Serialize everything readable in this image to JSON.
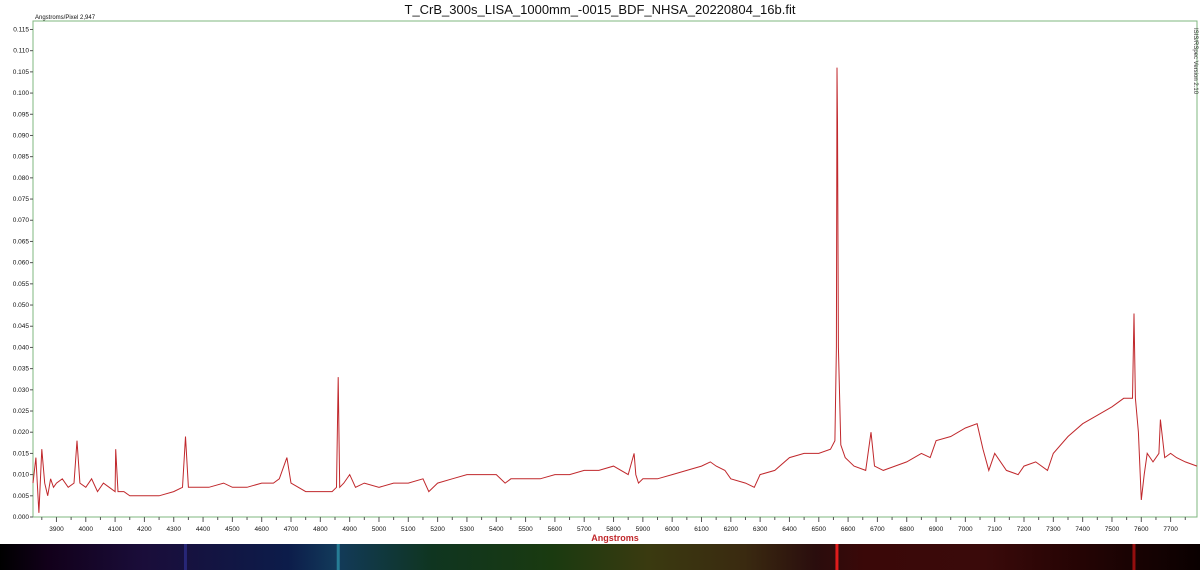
{
  "title": "T_CrB_300s_LISA_1000mm_-0015_BDF_NHSA_20220804_16b.fit",
  "dispersion_label": "Angstroms/Pixel 2,947",
  "app_credit": "ISIS/RSpec Version 2.10",
  "colors": {
    "line": "#c0282c",
    "axis_label": "#c0282c",
    "frame": "#7fb77f",
    "text": "#111111"
  },
  "chart_data": {
    "type": "line",
    "title": "T_CrB_300s_LISA_1000mm_-0015_BDF_NHSA_20220804_16b.fit",
    "xlabel": "Angstroms",
    "ylabel": "",
    "xlim": [
      3820,
      7790
    ],
    "ylim": [
      0,
      0.117
    ],
    "grid": false,
    "x_ticks": [
      3900,
      4000,
      4100,
      4200,
      4300,
      4400,
      4500,
      4600,
      4700,
      4800,
      4900,
      5000,
      5100,
      5200,
      5300,
      5400,
      5500,
      5600,
      5700,
      5800,
      5900,
      6000,
      6100,
      6200,
      6300,
      6400,
      6500,
      6600,
      6700,
      6800,
      6900,
      7000,
      7100,
      7200,
      7300,
      7400,
      7500,
      7600,
      7700
    ],
    "y_ticks": [
      "0.000",
      "0.005",
      "0.010",
      "0.015",
      "0.020",
      "0.025",
      "0.030",
      "0.035",
      "0.040",
      "0.045",
      "0.050",
      "0.055",
      "0.060",
      "0.065",
      "0.070",
      "0.075",
      "0.080",
      "0.085",
      "0.090",
      "0.095",
      "0.100",
      "0.105",
      "0.110",
      "0.115"
    ],
    "series": [
      {
        "x": [
          3820,
          3830,
          3840,
          3850,
          3860,
          3870,
          3880,
          3890,
          3900,
          3920,
          3940,
          3960,
          3970,
          3980,
          4000,
          4020,
          4040,
          4060,
          4080,
          4100,
          4102,
          4110,
          4130,
          4150,
          4200,
          4250,
          4300,
          4330,
          4340,
          4350,
          4380,
          4420,
          4470,
          4500,
          4550,
          4600,
          4640,
          4660,
          4686,
          4700,
          4750,
          4800,
          4840,
          4855,
          4861,
          4866,
          4880,
          4900,
          4920,
          4950,
          5000,
          5050,
          5100,
          5150,
          5170,
          5200,
          5250,
          5300,
          5350,
          5400,
          5430,
          5450,
          5500,
          5550,
          5600,
          5650,
          5700,
          5750,
          5800,
          5850,
          5870,
          5876,
          5885,
          5900,
          5950,
          6000,
          6050,
          6100,
          6130,
          6150,
          6180,
          6200,
          6250,
          6280,
          6300,
          6350,
          6400,
          6450,
          6500,
          6540,
          6555,
          6560,
          6562,
          6564,
          6567,
          6575,
          6590,
          6620,
          6660,
          6678,
          6690,
          6720,
          6760,
          6800,
          6850,
          6880,
          6900,
          6950,
          7000,
          7040,
          7060,
          7080,
          7100,
          7140,
          7180,
          7200,
          7240,
          7280,
          7300,
          7350,
          7400,
          7450,
          7500,
          7540,
          7570,
          7575,
          7580,
          7590,
          7600,
          7610,
          7620,
          7640,
          7660,
          7665,
          7680,
          7700,
          7720,
          7750,
          7790
        ],
        "y": [
          0.008,
          0.014,
          0.001,
          0.016,
          0.008,
          0.005,
          0.009,
          0.007,
          0.008,
          0.009,
          0.007,
          0.008,
          0.018,
          0.008,
          0.007,
          0.009,
          0.006,
          0.008,
          0.007,
          0.006,
          0.016,
          0.006,
          0.006,
          0.005,
          0.005,
          0.005,
          0.006,
          0.007,
          0.019,
          0.007,
          0.007,
          0.007,
          0.008,
          0.007,
          0.007,
          0.008,
          0.008,
          0.009,
          0.014,
          0.008,
          0.006,
          0.006,
          0.006,
          0.007,
          0.033,
          0.007,
          0.008,
          0.01,
          0.007,
          0.008,
          0.007,
          0.008,
          0.008,
          0.009,
          0.006,
          0.008,
          0.009,
          0.01,
          0.01,
          0.01,
          0.008,
          0.009,
          0.009,
          0.009,
          0.01,
          0.01,
          0.011,
          0.011,
          0.012,
          0.01,
          0.015,
          0.01,
          0.008,
          0.009,
          0.009,
          0.01,
          0.011,
          0.012,
          0.013,
          0.012,
          0.011,
          0.009,
          0.008,
          0.007,
          0.01,
          0.011,
          0.014,
          0.015,
          0.015,
          0.016,
          0.018,
          0.04,
          0.106,
          0.093,
          0.04,
          0.017,
          0.014,
          0.012,
          0.011,
          0.02,
          0.012,
          0.011,
          0.012,
          0.013,
          0.015,
          0.014,
          0.018,
          0.019,
          0.021,
          0.022,
          0.016,
          0.011,
          0.015,
          0.011,
          0.01,
          0.012,
          0.013,
          0.011,
          0.015,
          0.019,
          0.022,
          0.024,
          0.026,
          0.028,
          0.028,
          0.048,
          0.028,
          0.02,
          0.004,
          0.01,
          0.015,
          0.013,
          0.015,
          0.023,
          0.014,
          0.015,
          0.014,
          0.013,
          0.012
        ]
      }
    ]
  }
}
